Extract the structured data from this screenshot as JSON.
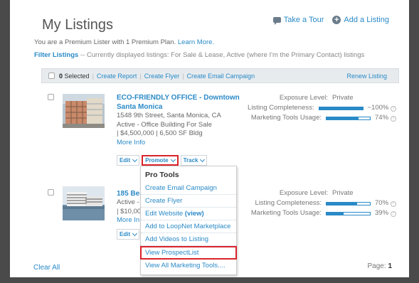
{
  "header": {
    "title": "My Listings",
    "tour_label": "Take a Tour",
    "add_label": "Add a Listing"
  },
  "subtitle": {
    "text": "You are a Premium Lister with 1 Premium Plan.",
    "link": "Learn More."
  },
  "filter": {
    "label": "Filter Listings",
    "text": " -- Currently displayed listings: For Sale & Lease, Active (where I'm the Primary Contact) listings"
  },
  "toolbar": {
    "selected_count": "0",
    "selected_label": "Selected",
    "create_report": "Create Report",
    "create_flyer": "Create Flyer",
    "create_email": "Create Email Campaign",
    "renew": "Renew Listing"
  },
  "listings": [
    {
      "name": "ECO-FRIENDLY OFFICE - Downtown Santa Monica",
      "address": "1548 9th Street, Santa Monica, CA",
      "status": "Active - Office Building For Sale",
      "price": "| $4,500,000 | 6,500 SF Bldg",
      "more": "More Info",
      "exposure_label": "Exposure Level:",
      "exposure_value": "Private",
      "completeness_label": "Listing Completeness:",
      "completeness_value": "~100%",
      "completeness_pct": 100,
      "marketing_label": "Marketing Tools Usage:",
      "marketing_value": "74%",
      "marketing_pct": 74
    },
    {
      "name": "185 Ber",
      "status": "Active -",
      "price": "| $10,00",
      "more": "More In",
      "exposure_label": "Exposure Level:",
      "exposure_value": "Private",
      "completeness_label": "Listing Completeness:",
      "completeness_value": "70%",
      "completeness_pct": 70,
      "marketing_label": "Marketing Tools Usage:",
      "marketing_value": "39%",
      "marketing_pct": 39
    }
  ],
  "buttons": {
    "edit": "Edit",
    "promote": "Promote",
    "track": "Track"
  },
  "dropdown": {
    "header": "Pro Tools",
    "items": [
      "Create Email Campaign",
      "Create Flyer",
      "Edit Website",
      "Add to LoopNet Marketplace",
      "Add Videos to Listing",
      "View ProspectList",
      "View All Marketing Tools...."
    ],
    "edit_website_suffix": "(view)"
  },
  "footer": {
    "clear": "Clear All",
    "page_label": "Page:",
    "page_num": "1"
  },
  "colors": {
    "accent": "#2a8ac7",
    "highlight": "#d9242b"
  }
}
